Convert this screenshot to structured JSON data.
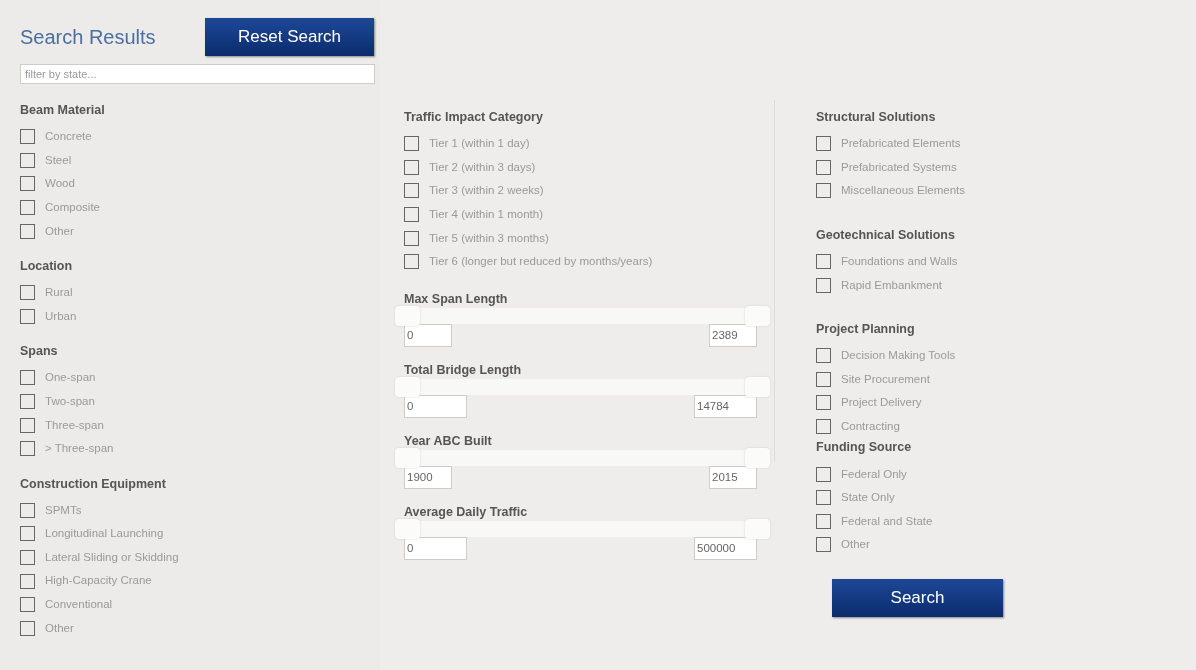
{
  "header": {
    "title": "Search Results",
    "reset_button": "Reset Search"
  },
  "filter": {
    "placeholder": "filter by state..."
  },
  "left_groups": [
    {
      "heading": "Beam Material",
      "options": [
        {
          "label": "Concrete",
          "checked": false
        },
        {
          "label": "Steel",
          "checked": false
        },
        {
          "label": "Wood",
          "checked": false
        },
        {
          "label": "Composite",
          "checked": false
        },
        {
          "label": "Other",
          "checked": false
        }
      ]
    },
    {
      "heading": "Location",
      "options": [
        {
          "label": "Rural",
          "checked": false
        },
        {
          "label": "Urban",
          "checked": false
        }
      ]
    },
    {
      "heading": "Spans",
      "options": [
        {
          "label": "One-span",
          "checked": false
        },
        {
          "label": "Two-span",
          "checked": false
        },
        {
          "label": "Three-span",
          "checked": false
        },
        {
          "label": "> Three-span",
          "checked": false
        }
      ]
    },
    {
      "heading": "Construction Equipment",
      "options": [
        {
          "label": "SPMTs",
          "checked": false
        },
        {
          "label": "Longitudinal Launching",
          "checked": false
        },
        {
          "label": "Lateral Sliding or Skidding",
          "checked": false
        },
        {
          "label": "High-Capacity Crane",
          "checked": false
        },
        {
          "label": "Conventional",
          "checked": false
        },
        {
          "label": "Other",
          "checked": false
        }
      ]
    }
  ],
  "traffic_impact": {
    "heading": "Traffic Impact Category",
    "options": [
      {
        "label": "Tier 1 (within 1 day)",
        "checked": false
      },
      {
        "label": "Tier 2 (within 3 days)",
        "checked": false
      },
      {
        "label": "Tier 3 (within 2 weeks)",
        "checked": false
      },
      {
        "label": "Tier 4 (within 1 month)",
        "checked": false
      },
      {
        "label": "Tier 5 (within 3 months)",
        "checked": false
      },
      {
        "label": "Tier 6 (longer but reduced by months/years)",
        "checked": false
      }
    ]
  },
  "ranges": [
    {
      "heading": "Max Span Length",
      "handles": [
        {
          "level": 0
        },
        {
          "level": 1
        }
      ],
      "min": "0",
      "max": "2389"
    },
    {
      "heading": "Total Bridge Length",
      "handles": [
        {
          "level": 0
        },
        {
          "level": 1
        }
      ],
      "min": "0",
      "max": "14784"
    },
    {
      "heading": "Year ABC Built",
      "handles": [
        {
          "level": 0
        },
        {
          "level": 1
        }
      ],
      "min": "1900",
      "max": "2015"
    },
    {
      "heading": "Average Daily Traffic",
      "handles": [
        {
          "level": 0
        },
        {
          "level": 1
        }
      ],
      "min": "0",
      "max": "500000"
    }
  ],
  "right_groups": [
    {
      "heading": "Structural Solutions",
      "options": [
        {
          "label": "Prefabricated Elements",
          "checked": false
        },
        {
          "label": "Prefabricated Systems",
          "checked": false
        },
        {
          "label": "Miscellaneous Elements",
          "checked": false
        }
      ]
    },
    {
      "heading": "Geotechnical Solutions",
      "options": [
        {
          "label": "Foundations and Walls",
          "checked": false
        },
        {
          "label": "Rapid Embankment",
          "checked": false
        }
      ]
    },
    {
      "heading": "Project Planning",
      "options": [
        {
          "label": "Decision Making Tools",
          "checked": false
        },
        {
          "label": "Site Procurement",
          "checked": false
        },
        {
          "label": "Project Delivery",
          "checked": false
        },
        {
          "label": "Contracting",
          "checked": false
        }
      ]
    },
    {
      "heading": "Funding Source",
      "options": [
        {
          "label": "Federal Only",
          "checked": false
        },
        {
          "label": "State Only",
          "checked": false
        },
        {
          "label": "Federal and State",
          "checked": false
        },
        {
          "label": "Other",
          "checked": false
        }
      ]
    }
  ],
  "search_button": "Search"
}
